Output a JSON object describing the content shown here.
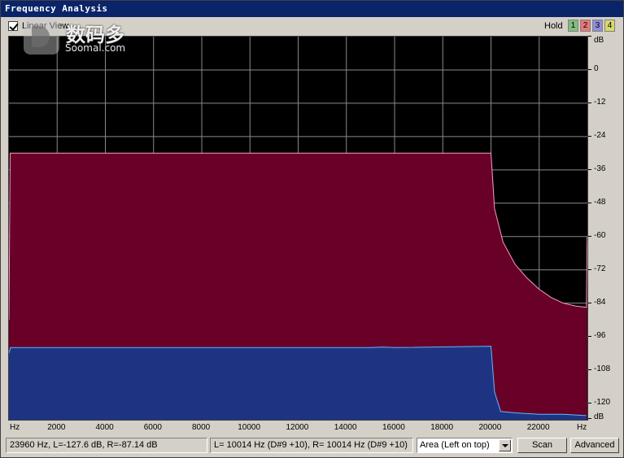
{
  "window": {
    "title": "Frequency Analysis"
  },
  "toolbar": {
    "linear_view_label": "Linear View",
    "hold_label": "Hold",
    "hold_buttons": [
      {
        "label": "1",
        "color": "#7fbf7f"
      },
      {
        "label": "2",
        "color": "#e87878"
      },
      {
        "label": "3",
        "color": "#8f8fd8"
      },
      {
        "label": "4",
        "color": "#d8d86a"
      }
    ]
  },
  "watermark": {
    "cn": "数码多",
    "en": "Soomal.com"
  },
  "chart_data": {
    "type": "area",
    "xlim": [
      0,
      24000
    ],
    "ylim": [
      -126,
      12
    ],
    "x_ticks": [
      "Hz",
      "2000",
      "4000",
      "6000",
      "8000",
      "10000",
      "12000",
      "14000",
      "16000",
      "18000",
      "20000",
      "22000",
      "Hz"
    ],
    "x_tick_values": [
      0,
      2000,
      4000,
      6000,
      8000,
      10000,
      12000,
      14000,
      16000,
      18000,
      20000,
      22000,
      23960
    ],
    "y_ticks": [
      "dB",
      "0",
      "-12",
      "-24",
      "-36",
      "-48",
      "-60",
      "-72",
      "-84",
      "-96",
      "-108",
      "-120",
      "dB"
    ],
    "y_tick_values": [
      12,
      0,
      -12,
      -24,
      -36,
      -48,
      -60,
      -72,
      -84,
      -96,
      -108,
      -120,
      -126
    ],
    "grid": true,
    "series": [
      {
        "color": "#680028",
        "stroke": "#ff9acb",
        "points": [
          [
            0,
            -90
          ],
          [
            50,
            -30
          ],
          [
            20000,
            -30
          ],
          [
            20150,
            -50
          ],
          [
            20500,
            -62
          ],
          [
            21000,
            -70
          ],
          [
            21500,
            -75
          ],
          [
            22000,
            -79
          ],
          [
            22500,
            -82
          ],
          [
            23000,
            -84
          ],
          [
            23500,
            -85
          ],
          [
            23960,
            -85.5
          ],
          [
            23990,
            -60
          ]
        ]
      },
      {
        "color": "#1e3482",
        "stroke": "#5fb8ff",
        "points": [
          [
            0,
            -102
          ],
          [
            60,
            -100
          ],
          [
            15000,
            -100
          ],
          [
            15500,
            -99.8
          ],
          [
            16000,
            -100
          ],
          [
            20000,
            -99.5
          ],
          [
            20150,
            -116
          ],
          [
            20400,
            -123
          ],
          [
            21000,
            -123.5
          ],
          [
            22000,
            -124
          ],
          [
            23000,
            -124
          ],
          [
            23960,
            -124.5
          ]
        ]
      }
    ]
  },
  "status": {
    "cursor": "23960 Hz, L=-127.6 dB, R=-87.14 dB",
    "peak": "L=  10014 Hz (D#9 +10), R=  10014 Hz (D#9 +10)",
    "view_mode": "Area (Left on top)",
    "scan_label": "Scan",
    "advanced_label": "Advanced"
  }
}
